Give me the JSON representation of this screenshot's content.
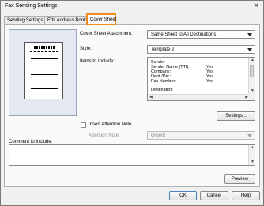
{
  "window": {
    "title": "Fax Sending Settings",
    "close_glyph": "✕"
  },
  "tabs": [
    {
      "label": "Sending Settings"
    },
    {
      "label": "Edit Address Book"
    },
    {
      "label": "Cover Sheet"
    }
  ],
  "cover_sheet_attachment": {
    "label": "Cover Sheet Attachment:",
    "value": "Same Sheet to All Destinations"
  },
  "style": {
    "label": "Style:",
    "value": "Template 2"
  },
  "items_to_include": {
    "label": "Items to Include:",
    "rows": [
      {
        "name": "Sender",
        "value": ""
      },
      {
        "name": "Sender Name (TTI):",
        "value": "Yes"
      },
      {
        "name": "Company:",
        "value": "Yes"
      },
      {
        "name": "Dept./Div.:",
        "value": "Yes"
      },
      {
        "name": "Fax Number:",
        "value": "Yes"
      },
      {
        "name": "Destination",
        "value": ""
      }
    ]
  },
  "settings_button": "Settings...",
  "attention_note": {
    "checkbox_label": "Insert Attention Note",
    "checked": false,
    "field_label": "Attention Note:",
    "value": "Urgent"
  },
  "comment": {
    "label": "Comment to Include:",
    "value": ""
  },
  "preview_button": "Preview",
  "footer": {
    "ok": "OK",
    "cancel": "Cancel",
    "help": "Help"
  },
  "colors": {
    "active_tab_border": "#f08c1e",
    "default_button_border": "#4a7fc0"
  }
}
